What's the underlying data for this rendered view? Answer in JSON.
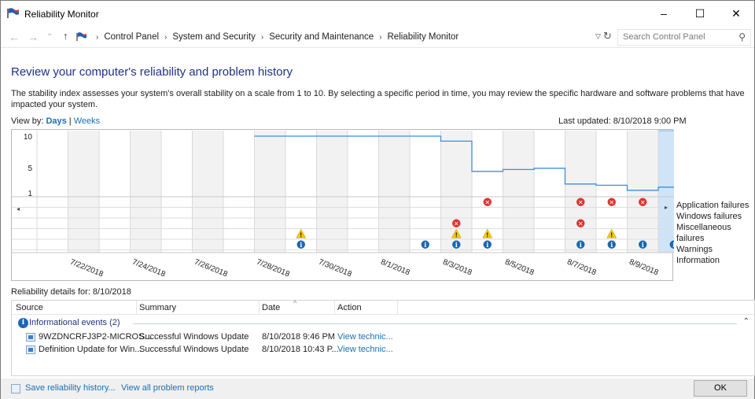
{
  "window": {
    "title": "Reliability Monitor",
    "buttons": {
      "minimize": "–",
      "maximize": "☐",
      "close": "✕"
    }
  },
  "address": {
    "crumbs": [
      "Control Panel",
      "System and Security",
      "Security and Maintenance",
      "Reliability Monitor"
    ],
    "search_placeholder": "Search Control Panel"
  },
  "content": {
    "heading": "Review your computer's reliability and problem history",
    "description": "The stability index assesses your system's overall stability on a scale from 1 to 10. By selecting a specific period in time, you may review the specific hardware and software problems that have impacted your system.",
    "view_by_label": "View by:",
    "view_days": "Days",
    "view_sep": "|",
    "view_weeks": "Weeks",
    "last_updated": "Last updated: 8/10/2018 9:00 PM"
  },
  "chart_data": {
    "type": "line",
    "title": "",
    "y_ticks": [
      "10",
      "5",
      "1"
    ],
    "ylim": [
      1,
      10
    ],
    "x_labels": [
      "7/22/2018",
      "7/24/2018",
      "7/26/2018",
      "7/28/2018",
      "7/30/2018",
      "8/1/2018",
      "8/3/2018",
      "8/5/2018",
      "8/7/2018",
      "8/9/2018"
    ],
    "days": [
      "7/21",
      "7/22",
      "7/23",
      "7/24",
      "7/25",
      "7/26",
      "7/27",
      "7/28",
      "7/29",
      "7/30",
      "7/31",
      "8/1",
      "8/2",
      "8/3",
      "8/4",
      "8/5",
      "8/6",
      "8/7",
      "8/8",
      "8/9"
    ],
    "stability_index": [
      null,
      null,
      null,
      null,
      null,
      null,
      null,
      10,
      10,
      10,
      10,
      10,
      10,
      9.2,
      4.4,
      4.7,
      4.9,
      2.4,
      2.2,
      1.4,
      1.9
    ],
    "legend": [
      "Application failures",
      "Windows failures",
      "Miscellaneous failures",
      "Warnings",
      "Information"
    ],
    "events": {
      "application_failures": [
        "8/4",
        "8/7",
        "8/8",
        "8/9"
      ],
      "windows_failures": [],
      "miscellaneous_failures": [
        "8/3",
        "8/7"
      ],
      "warnings": [
        "7/29",
        "8/3",
        "8/4",
        "8/8"
      ],
      "information": [
        "7/29",
        "8/2",
        "8/3",
        "8/4",
        "8/7",
        "8/8",
        "8/9",
        "8/10"
      ]
    },
    "selected_day": "8/10",
    "colors": {
      "line": "#3c8fdc",
      "selected": "#cfe4f7",
      "error": "#e0322e",
      "warning": "#f5c800",
      "info": "#1967b3"
    }
  },
  "details": {
    "label": "Reliability details for: 8/10/2018",
    "columns": [
      "Source",
      "Summary",
      "Date",
      "Action"
    ],
    "group_label": "Informational events (2)",
    "rows": [
      {
        "source": "9WZDNCRFJ3P2-MICROS...",
        "summary": "Successful Windows Update",
        "date": "8/10/2018 9:46 PM",
        "action": "View  technic..."
      },
      {
        "source": "Definition Update for Win...",
        "summary": "Successful Windows Update",
        "date": "8/10/2018 10:43 P...",
        "action": "View  technic..."
      }
    ]
  },
  "footer": {
    "save": "Save reliability history...",
    "view_all": "View all problem reports",
    "ok": "OK"
  }
}
